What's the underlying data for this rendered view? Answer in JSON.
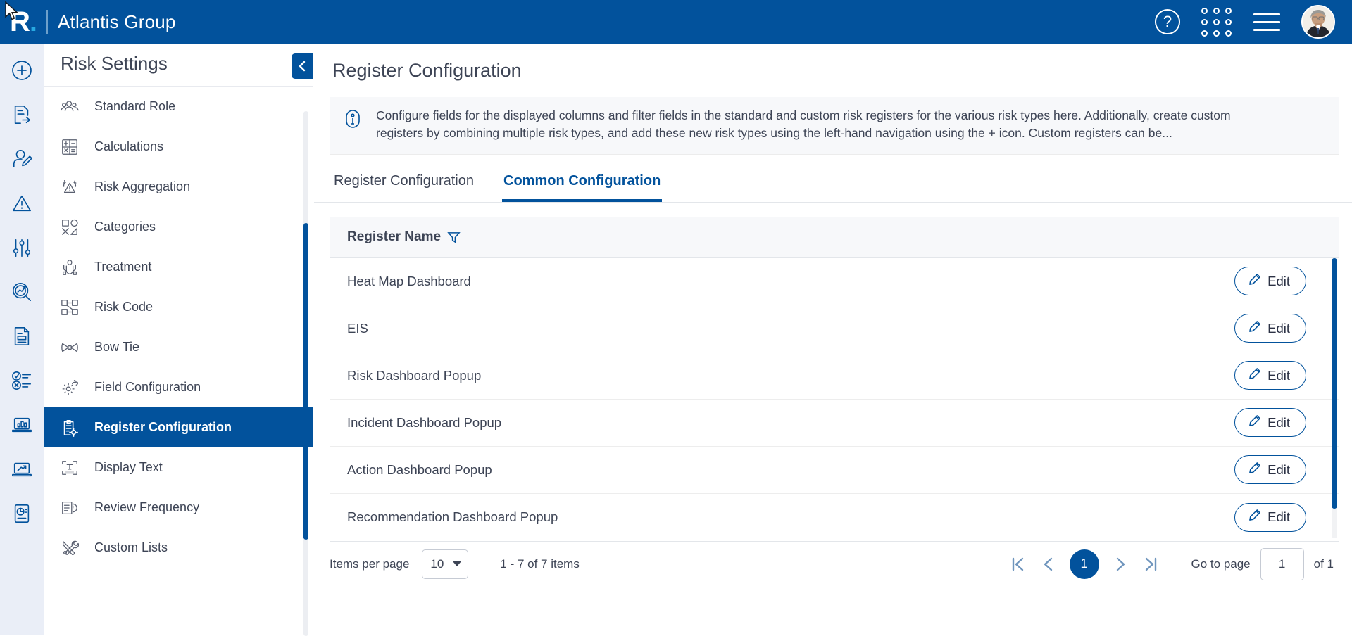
{
  "topbar": {
    "logo_letter": "R",
    "logo_dot": ".",
    "org_title": "Atlantis Group",
    "icons": {
      "help": "help-circle-icon",
      "apps": "apps-grid-icon",
      "menu": "hamburger-menu-icon",
      "avatar": "user-avatar"
    }
  },
  "rail": {
    "items": [
      {
        "name": "add-new-icon"
      },
      {
        "name": "document-export-icon"
      },
      {
        "name": "user-edit-icon"
      },
      {
        "name": "risk-warning-icon"
      },
      {
        "name": "settings-sliders-icon"
      },
      {
        "name": "analytics-search-icon"
      },
      {
        "name": "document-report-icon"
      },
      {
        "name": "checklist-status-icon"
      },
      {
        "name": "bar-chart-laptop-icon"
      },
      {
        "name": "trend-laptop-icon"
      },
      {
        "name": "pie-report-icon"
      }
    ]
  },
  "sidebar": {
    "title": "Risk Settings",
    "collapse_icon": "chevron-left-icon",
    "items": [
      {
        "label": "Standard Role",
        "icon": "people-icon",
        "active": false
      },
      {
        "label": "Calculations",
        "icon": "calculator-icon",
        "active": false
      },
      {
        "label": "Risk Aggregation",
        "icon": "aggregation-warning-icon",
        "active": false
      },
      {
        "label": "Categories",
        "icon": "shapes-icon",
        "active": false
      },
      {
        "label": "Treatment",
        "icon": "hands-care-icon",
        "active": false
      },
      {
        "label": "Risk Code",
        "icon": "flow-nodes-icon",
        "active": false
      },
      {
        "label": "Bow Tie",
        "icon": "bow-tie-icon",
        "active": false
      },
      {
        "label": "Field Configuration",
        "icon": "gears-icon",
        "active": false
      },
      {
        "label": "Register Configuration",
        "icon": "clipboard-gear-icon",
        "active": true
      },
      {
        "label": "Display Text",
        "icon": "text-scan-icon",
        "active": false
      },
      {
        "label": "Review Frequency",
        "icon": "document-clock-icon",
        "active": false
      },
      {
        "label": "Custom Lists",
        "icon": "tools-icon",
        "active": false
      }
    ]
  },
  "main": {
    "page_title": "Register Configuration",
    "banner": {
      "icon": "info-icon",
      "text": "Configure fields for the displayed columns and filter fields in the standard and custom risk registers for the various risk types here. Additionally, create custom registers by combining multiple risk types, and add these new risk types using the left-hand navigation using the + icon. Custom registers can be..."
    },
    "tabs": [
      {
        "label": "Register Configuration",
        "active": false
      },
      {
        "label": "Common Configuration",
        "active": true
      }
    ],
    "grid": {
      "column_header": "Register Name",
      "filter_icon": "filter-funnel-icon",
      "edit_label": "Edit",
      "edit_icon": "pencil-icon",
      "rows": [
        {
          "name": "Heat Map Dashboard"
        },
        {
          "name": "EIS"
        },
        {
          "name": "Risk Dashboard Popup"
        },
        {
          "name": "Incident Dashboard Popup"
        },
        {
          "name": "Action Dashboard Popup"
        },
        {
          "name": "Recommendation Dashboard Popup"
        }
      ]
    },
    "pager": {
      "items_per_page_label": "Items per page",
      "items_per_page_value": "10",
      "range_text": "1 - 7 of 7 items",
      "current_page": "1",
      "goto_label": "Go to page",
      "goto_value": "1",
      "of_text": "of 1",
      "first_icon": "first-page-icon",
      "prev_icon": "prev-page-icon",
      "next_icon": "next-page-icon",
      "last_icon": "last-page-icon"
    }
  },
  "colors": {
    "brand_blue": "#02529C",
    "accent_cyan": "#27A9E1",
    "rail_bg": "#eaeef7",
    "text": "#3d4455"
  }
}
